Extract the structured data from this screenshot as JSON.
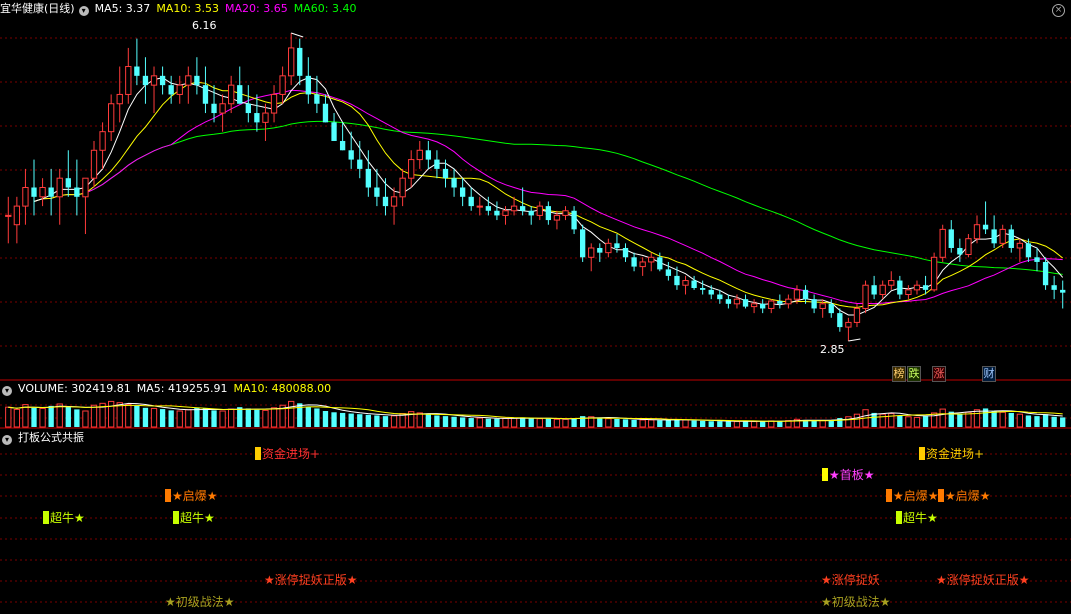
{
  "header": {
    "stock_name": "宜华健康(日线)",
    "ma5_label": "MA5: 3.37",
    "ma10_label": "MA10: 3.53",
    "ma20_label": "MA20: 3.65",
    "ma60_label": "MA60: 3.40"
  },
  "volume_header": {
    "volume_label": "VOLUME: 302419.81",
    "ma5_label": "MA5: 419255.91",
    "ma10_label": "MA10: 480088.00"
  },
  "indicator_header": {
    "title": "打板公式共振"
  },
  "annotations": {
    "high": "6.16",
    "low": "2.85"
  },
  "badges": [
    "榜",
    "跌",
    "涨",
    "财"
  ],
  "signals": [
    {
      "text": "超牛★",
      "color": "#c8ff00"
    },
    {
      "text": "超牛★",
      "color": "#c8ff00"
    },
    {
      "text": "超牛★",
      "color": "#c8ff00"
    },
    {
      "text": "★启爆★",
      "color": "#ff7a00"
    },
    {
      "text": "★启爆★",
      "color": "#ff7a00"
    },
    {
      "text": "★启爆★",
      "color": "#ff7a00"
    },
    {
      "text": "资金进场+",
      "color": "#ff3030"
    },
    {
      "text": "资金进场+",
      "color": "#ffcc00"
    },
    {
      "text": "★首板★",
      "color": "#ff40ff"
    },
    {
      "text": "★涨停捉妖正版★",
      "color": "#ff4020"
    },
    {
      "text": "★涨停捉妖",
      "color": "#ff4020"
    },
    {
      "text": "★涨停捉妖正版★",
      "color": "#ff4020"
    },
    {
      "text": "★初级战法★",
      "color": "#a8a020"
    },
    {
      "text": "★初级战法★",
      "color": "#a8a020"
    }
  ],
  "colors": {
    "up": "#ff3b3b",
    "down": "#54ffff",
    "ma5": "#ffffff",
    "ma10": "#ffff00",
    "ma20": "#ff00ff",
    "ma60": "#00ff00",
    "grid": "#7a0000",
    "divider": "#c00000"
  },
  "chart_data": [
    {
      "type": "candlestick",
      "title": "宜华健康(日线)",
      "yrange": [
        2.7,
        6.3
      ],
      "ohlc": [
        [
          4.2,
          4.4,
          3.9,
          4.2
        ],
        [
          4.1,
          4.4,
          3.9,
          4.3
        ],
        [
          4.3,
          4.7,
          4.1,
          4.5
        ],
        [
          4.5,
          4.8,
          4.2,
          4.4
        ],
        [
          4.4,
          4.6,
          4.3,
          4.5
        ],
        [
          4.5,
          4.7,
          4.2,
          4.4
        ],
        [
          4.4,
          4.7,
          4.1,
          4.6
        ],
        [
          4.6,
          4.9,
          4.4,
          4.5
        ],
        [
          4.5,
          4.8,
          4.2,
          4.4
        ],
        [
          4.4,
          4.6,
          4.0,
          4.6
        ],
        [
          4.6,
          5.0,
          4.5,
          4.9
        ],
        [
          4.9,
          5.2,
          4.7,
          5.1
        ],
        [
          5.1,
          5.5,
          5.0,
          5.4
        ],
        [
          5.4,
          5.8,
          5.2,
          5.5
        ],
        [
          5.5,
          6.0,
          5.4,
          5.8
        ],
        [
          5.8,
          6.1,
          5.6,
          5.7
        ],
        [
          5.7,
          5.9,
          5.4,
          5.6
        ],
        [
          5.6,
          5.8,
          5.3,
          5.7
        ],
        [
          5.7,
          5.8,
          5.5,
          5.6
        ],
        [
          5.6,
          5.7,
          5.4,
          5.5
        ],
        [
          5.5,
          5.7,
          5.4,
          5.6
        ],
        [
          5.6,
          5.8,
          5.4,
          5.7
        ],
        [
          5.7,
          5.9,
          5.5,
          5.6
        ],
        [
          5.6,
          5.8,
          5.3,
          5.4
        ],
        [
          5.4,
          5.6,
          5.2,
          5.3
        ],
        [
          5.3,
          5.5,
          5.1,
          5.4
        ],
        [
          5.4,
          5.7,
          5.3,
          5.6
        ],
        [
          5.6,
          5.8,
          5.4,
          5.4
        ],
        [
          5.4,
          5.6,
          5.2,
          5.3
        ],
        [
          5.3,
          5.5,
          5.1,
          5.2
        ],
        [
          5.2,
          5.4,
          5.0,
          5.3
        ],
        [
          5.3,
          5.6,
          5.2,
          5.5
        ],
        [
          5.5,
          5.8,
          5.4,
          5.7
        ],
        [
          5.7,
          6.16,
          5.6,
          6.0
        ],
        [
          6.0,
          6.1,
          5.6,
          5.7
        ],
        [
          5.7,
          5.9,
          5.4,
          5.5
        ],
        [
          5.5,
          5.7,
          5.3,
          5.4
        ],
        [
          5.4,
          5.5,
          5.2,
          5.2
        ],
        [
          5.2,
          5.3,
          5.0,
          5.0
        ],
        [
          5.0,
          5.2,
          4.9,
          4.9
        ],
        [
          4.9,
          5.1,
          4.7,
          4.8
        ],
        [
          4.8,
          5.0,
          4.6,
          4.7
        ],
        [
          4.7,
          4.9,
          4.4,
          4.5
        ],
        [
          4.5,
          4.7,
          4.3,
          4.4
        ],
        [
          4.4,
          4.6,
          4.2,
          4.3
        ],
        [
          4.3,
          4.5,
          4.1,
          4.4
        ],
        [
          4.4,
          4.7,
          4.3,
          4.6
        ],
        [
          4.6,
          4.9,
          4.5,
          4.8
        ],
        [
          4.8,
          5.0,
          4.7,
          4.9
        ],
        [
          4.9,
          5.0,
          4.7,
          4.8
        ],
        [
          4.8,
          4.9,
          4.6,
          4.7
        ],
        [
          4.7,
          4.8,
          4.5,
          4.6
        ],
        [
          4.6,
          4.7,
          4.4,
          4.5
        ],
        [
          4.5,
          4.6,
          4.3,
          4.4
        ],
        [
          4.4,
          4.5,
          4.25,
          4.3
        ],
        [
          4.3,
          4.4,
          4.2,
          4.3
        ],
        [
          4.3,
          4.4,
          4.2,
          4.25
        ],
        [
          4.25,
          4.35,
          4.15,
          4.2
        ],
        [
          4.2,
          4.3,
          4.1,
          4.25
        ],
        [
          4.25,
          4.4,
          4.2,
          4.3
        ],
        [
          4.3,
          4.5,
          4.2,
          4.25
        ],
        [
          4.25,
          4.3,
          4.1,
          4.2
        ],
        [
          4.2,
          4.35,
          4.15,
          4.3
        ],
        [
          4.3,
          4.35,
          4.1,
          4.15
        ],
        [
          4.15,
          4.25,
          4.05,
          4.2
        ],
        [
          4.2,
          4.3,
          4.15,
          4.25
        ],
        [
          4.25,
          4.3,
          4.0,
          4.05
        ],
        [
          4.05,
          4.1,
          3.7,
          3.75
        ],
        [
          3.75,
          3.9,
          3.6,
          3.85
        ],
        [
          3.85,
          3.9,
          3.7,
          3.8
        ],
        [
          3.8,
          3.95,
          3.75,
          3.9
        ],
        [
          3.9,
          4.0,
          3.8,
          3.85
        ],
        [
          3.85,
          3.9,
          3.7,
          3.75
        ],
        [
          3.75,
          3.8,
          3.6,
          3.65
        ],
        [
          3.65,
          3.75,
          3.55,
          3.7
        ],
        [
          3.7,
          3.8,
          3.6,
          3.75
        ],
        [
          3.75,
          3.8,
          3.6,
          3.62
        ],
        [
          3.62,
          3.7,
          3.5,
          3.55
        ],
        [
          3.55,
          3.65,
          3.4,
          3.45
        ],
        [
          3.45,
          3.55,
          3.35,
          3.5
        ],
        [
          3.5,
          3.55,
          3.4,
          3.42
        ],
        [
          3.42,
          3.5,
          3.35,
          3.4
        ],
        [
          3.4,
          3.45,
          3.3,
          3.35
        ],
        [
          3.35,
          3.4,
          3.25,
          3.3
        ],
        [
          3.3,
          3.35,
          3.2,
          3.25
        ],
        [
          3.25,
          3.35,
          3.2,
          3.3
        ],
        [
          3.3,
          3.35,
          3.2,
          3.22
        ],
        [
          3.22,
          3.3,
          3.15,
          3.25
        ],
        [
          3.25,
          3.3,
          3.15,
          3.2
        ],
        [
          3.2,
          3.3,
          3.15,
          3.28
        ],
        [
          3.28,
          3.35,
          3.2,
          3.25
        ],
        [
          3.25,
          3.35,
          3.2,
          3.3
        ],
        [
          3.3,
          3.45,
          3.25,
          3.4
        ],
        [
          3.4,
          3.45,
          3.25,
          3.3
        ],
        [
          3.3,
          3.35,
          3.15,
          3.2
        ],
        [
          3.2,
          3.3,
          3.1,
          3.25
        ],
        [
          3.25,
          3.3,
          3.1,
          3.15
        ],
        [
          3.15,
          3.2,
          2.95,
          3.0
        ],
        [
          3.0,
          3.1,
          2.85,
          3.05
        ],
        [
          3.05,
          3.25,
          3.0,
          3.2
        ],
        [
          3.2,
          3.5,
          3.15,
          3.45
        ],
        [
          3.45,
          3.55,
          3.3,
          3.35
        ],
        [
          3.35,
          3.5,
          3.3,
          3.45
        ],
        [
          3.45,
          3.6,
          3.4,
          3.5
        ],
        [
          3.5,
          3.55,
          3.3,
          3.35
        ],
        [
          3.35,
          3.45,
          3.3,
          3.4
        ],
        [
          3.4,
          3.5,
          3.35,
          3.45
        ],
        [
          3.45,
          3.55,
          3.35,
          3.4
        ],
        [
          3.4,
          3.8,
          3.38,
          3.75
        ],
        [
          3.75,
          4.1,
          3.7,
          4.05
        ],
        [
          4.05,
          4.15,
          3.8,
          3.85
        ],
        [
          3.85,
          3.95,
          3.7,
          3.78
        ],
        [
          3.78,
          4.0,
          3.75,
          3.95
        ],
        [
          3.95,
          4.2,
          3.9,
          4.1
        ],
        [
          4.1,
          4.35,
          4.0,
          4.05
        ],
        [
          4.05,
          4.2,
          3.85,
          3.9
        ],
        [
          3.9,
          4.1,
          3.85,
          4.05
        ],
        [
          4.05,
          4.1,
          3.8,
          3.85
        ],
        [
          3.85,
          3.95,
          3.7,
          3.9
        ],
        [
          3.9,
          3.95,
          3.7,
          3.75
        ],
        [
          3.75,
          3.85,
          3.6,
          3.7
        ],
        [
          3.7,
          3.75,
          3.4,
          3.45
        ],
        [
          3.45,
          3.55,
          3.3,
          3.4
        ],
        [
          3.4,
          3.5,
          3.2,
          3.37
        ]
      ],
      "ma_current": {
        "MA5": 3.37,
        "MA10": 3.53,
        "MA20": 3.65,
        "MA60": 3.4
      },
      "annotations": [
        {
          "label": "6.16",
          "value": 6.16
        },
        {
          "label": "2.85",
          "value": 2.85
        }
      ]
    },
    {
      "type": "bar",
      "title": "VOLUME",
      "current": 302419.81,
      "ma5": 419255.91,
      "ma10": 480088.0,
      "values": [
        0.62,
        0.55,
        0.7,
        0.6,
        0.58,
        0.66,
        0.72,
        0.64,
        0.55,
        0.5,
        0.68,
        0.74,
        0.8,
        0.76,
        0.7,
        0.66,
        0.6,
        0.58,
        0.56,
        0.52,
        0.5,
        0.54,
        0.6,
        0.58,
        0.52,
        0.5,
        0.56,
        0.62,
        0.58,
        0.54,
        0.52,
        0.6,
        0.68,
        0.8,
        0.74,
        0.64,
        0.58,
        0.5,
        0.46,
        0.44,
        0.42,
        0.4,
        0.38,
        0.36,
        0.34,
        0.35,
        0.42,
        0.48,
        0.44,
        0.4,
        0.36,
        0.34,
        0.32,
        0.3,
        0.28,
        0.28,
        0.26,
        0.26,
        0.27,
        0.28,
        0.3,
        0.27,
        0.26,
        0.26,
        0.24,
        0.24,
        0.28,
        0.34,
        0.32,
        0.28,
        0.26,
        0.25,
        0.24,
        0.22,
        0.22,
        0.22,
        0.21,
        0.22,
        0.24,
        0.22,
        0.2,
        0.19,
        0.18,
        0.18,
        0.17,
        0.17,
        0.18,
        0.17,
        0.18,
        0.19,
        0.19,
        0.2,
        0.24,
        0.22,
        0.2,
        0.2,
        0.22,
        0.28,
        0.32,
        0.4,
        0.54,
        0.44,
        0.4,
        0.42,
        0.36,
        0.32,
        0.3,
        0.34,
        0.44,
        0.56,
        0.48,
        0.42,
        0.46,
        0.54,
        0.58,
        0.5,
        0.46,
        0.44,
        0.4,
        0.36,
        0.34,
        0.4,
        0.32,
        0.3
      ]
    }
  ]
}
